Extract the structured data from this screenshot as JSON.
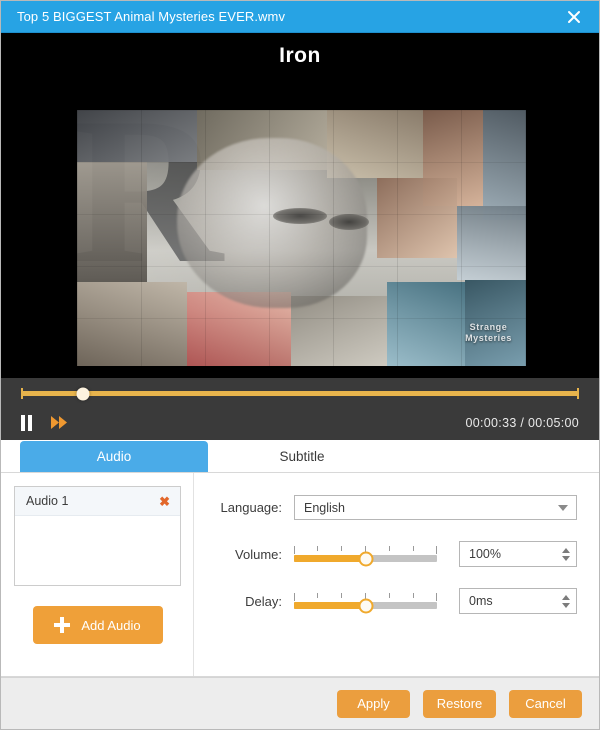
{
  "window": {
    "title": "Top 5 BIGGEST Animal Mysteries EVER.wmv",
    "close_icon": "close-icon",
    "titlebar_color": "#27a3e4"
  },
  "video": {
    "heading": "Iron",
    "watermark_line1": "Strange",
    "watermark_line2": "Mysteries"
  },
  "player": {
    "pause_icon": "pause-icon",
    "fast_forward_icon": "fast-forward-icon",
    "current_time": "00:00:33",
    "separator": "/",
    "total_time": "00:05:00",
    "progress_percent": 11,
    "accent_color": "#e8b44c"
  },
  "tabs": [
    {
      "label": "Audio",
      "active": true
    },
    {
      "label": "Subtitle",
      "active": false
    }
  ],
  "audio_panel": {
    "tracks": [
      {
        "label": "Audio 1",
        "remove_icon": "close-icon"
      }
    ],
    "add_button": {
      "label": "Add Audio",
      "icon": "plus-icon"
    },
    "fields": {
      "language": {
        "label": "Language:",
        "value": "English",
        "caret_icon": "chevron-down-icon"
      },
      "volume": {
        "label": "Volume:",
        "value": "100%",
        "slider_percent": 50
      },
      "delay": {
        "label": "Delay:",
        "value": "0ms",
        "slider_percent": 50
      }
    }
  },
  "footer": {
    "apply_label": "Apply",
    "restore_label": "Restore",
    "cancel_label": "Cancel",
    "button_color": "#eb9e3e"
  }
}
